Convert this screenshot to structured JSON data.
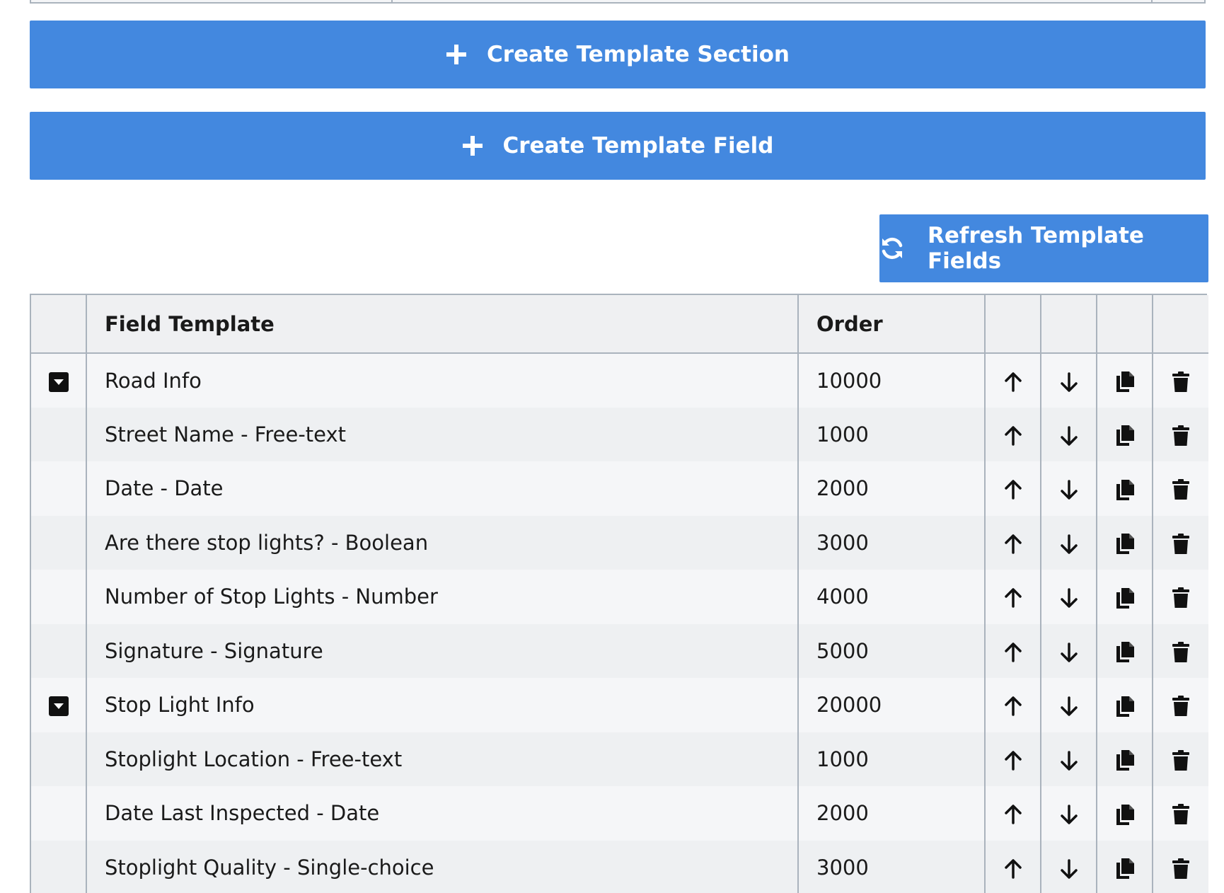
{
  "buttons": {
    "create_section": "Create Template Section",
    "create_field": "Create Template Field",
    "refresh": "Refresh Template Fields"
  },
  "table": {
    "headers": {
      "toggle": "",
      "field_template": "Field Template",
      "order": "Order"
    },
    "rows": [
      {
        "name": "Road Info",
        "order": "10000",
        "section": true
      },
      {
        "name": "Street Name - Free-text",
        "order": "1000",
        "section": false
      },
      {
        "name": "Date - Date",
        "order": "2000",
        "section": false
      },
      {
        "name": "Are there stop lights? - Boolean",
        "order": "3000",
        "section": false
      },
      {
        "name": "Number of Stop Lights - Number",
        "order": "4000",
        "section": false
      },
      {
        "name": "Signature - Signature",
        "order": "5000",
        "section": false
      },
      {
        "name": "Stop Light Info",
        "order": "20000",
        "section": true
      },
      {
        "name": "Stoplight Location - Free-text",
        "order": "1000",
        "section": false
      },
      {
        "name": "Date Last Inspected - Date",
        "order": "2000",
        "section": false
      },
      {
        "name": "Stoplight Quality - Single-choice",
        "order": "3000",
        "section": false
      }
    ]
  },
  "icons": {
    "create": "plus-icon",
    "refresh": "sync-icon",
    "toggle": "caret-down-icon",
    "actions": [
      "arrow-up-icon",
      "arrow-down-icon",
      "copy-icon",
      "trash-icon"
    ]
  },
  "colors": {
    "primary_button": "#4388df",
    "table_border": "#aab3bd",
    "header_bg": "#eff0f2"
  }
}
